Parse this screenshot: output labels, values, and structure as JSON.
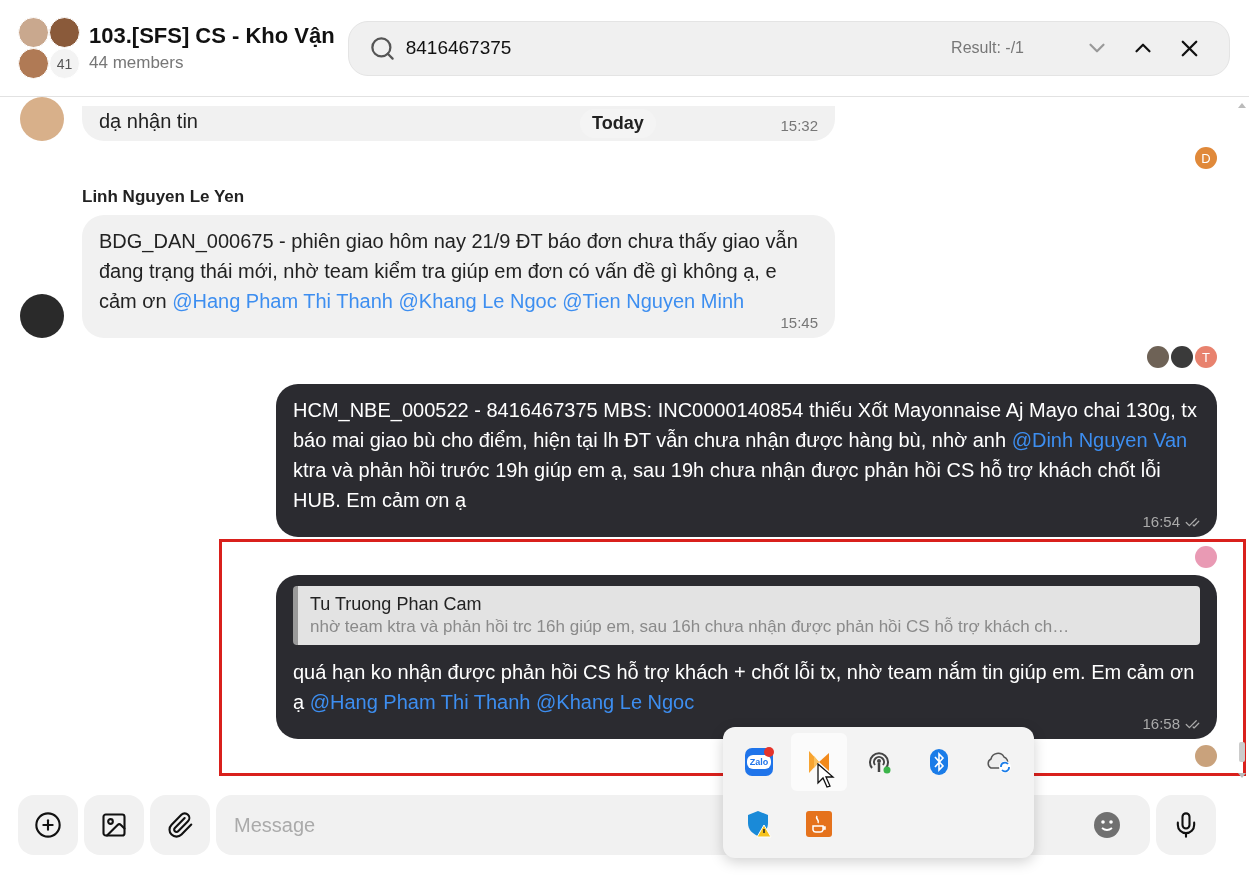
{
  "header": {
    "title": "103.[SFS] CS - Kho Vận",
    "subtitle": "44 members",
    "member_count": "41"
  },
  "search": {
    "value": "8416467375",
    "result": "Result: -/1",
    "next_disabled": true,
    "prev_disabled": false
  },
  "date_label": "Today",
  "rows": [
    {
      "kind": "message",
      "outgoing": false,
      "avatar": true,
      "top_cut": true,
      "highlighted": false,
      "time": "15:32",
      "parts": [
        {
          "kind": "text",
          "text": "dạ nhận tin"
        }
      ]
    },
    {
      "kind": "receipts",
      "highlighted": false,
      "readers": [
        {
          "kind": "letter",
          "letter": "D",
          "color": "#e0893a"
        }
      ]
    },
    {
      "kind": "sender",
      "name": "Linh Nguyen Le Yen"
    },
    {
      "kind": "message",
      "outgoing": false,
      "avatar": true,
      "top_cut": false,
      "highlighted": false,
      "time": "15:45",
      "parts": [
        {
          "kind": "text",
          "text": "BDG_DAN_000675 - phiên giao hôm nay 21/9 ĐT báo đơn chưa thấy giao vẫn đang trạng thái mới, nhờ team kiểm tra giúp em đơn có vấn đề gì không ạ, e cảm ơn "
        },
        {
          "kind": "mention",
          "text": "@Hang Pham Thi Thanh"
        },
        {
          "kind": "mention",
          "text": "@Khang Le Ngoc"
        },
        {
          "kind": "mention",
          "text": "@Tien Nguyen Minh"
        }
      ]
    },
    {
      "kind": "receipts",
      "highlighted": false,
      "readers": [
        {
          "kind": "photo",
          "color": "#6e6256"
        },
        {
          "kind": "photo",
          "color": "#3a3a3a"
        },
        {
          "kind": "letter",
          "letter": "T",
          "color": "#e8826e"
        }
      ]
    },
    {
      "kind": "message",
      "outgoing": true,
      "top_cut": false,
      "read": true,
      "highlighted": false,
      "time": "16:54",
      "parts": [
        {
          "kind": "text",
          "text": "HCM_NBE_000522 - 8416467375 MBS: INC0000140854 thiếu Xốt Mayonnaise Aj Mayo chai 130g, tx báo mai giao bù cho điểm, hiện tại lh ĐT vẫn chưa nhận được hàng bù, nhờ anh "
        },
        {
          "kind": "mention",
          "text": "@Dinh Nguyen Van"
        },
        {
          "kind": "text",
          "text": " ktra và phản hồi trước 19h giúp em ạ, sau 19h chưa nhận được phản hồi CS hỗ trợ khách chốt lỗi HUB. Em cảm ơn ạ"
        }
      ]
    },
    {
      "kind": "receipts",
      "highlighted": true,
      "readers": [
        {
          "kind": "photo",
          "color": "#e99ab4"
        }
      ]
    },
    {
      "kind": "message",
      "outgoing": true,
      "top_cut": false,
      "read": true,
      "highlighted": true,
      "time": "16:58",
      "quote": {
        "sender": "Tu Truong Phan Cam",
        "text": "nhờ team ktra và phản hồi trc 16h giúp em, sau 16h chưa nhận được phản hồi CS hỗ trợ khách ch…"
      },
      "parts": [
        {
          "kind": "text",
          "text": "quá hạn ko nhận được phản hồi CS hỗ trợ khách + chốt lỗi tx, nhờ team nắm tin giúp em. Em cảm ơn ạ "
        },
        {
          "kind": "mention",
          "text": "@Hang Pham Thi Thanh"
        },
        {
          "kind": "mention",
          "text": "@Khang Le Ngoc"
        }
      ]
    },
    {
      "kind": "receipts",
      "highlighted": true,
      "readers": [
        {
          "kind": "photo",
          "color": "#c9a27c"
        }
      ]
    }
  ],
  "composer": {
    "placeholder": "Message"
  },
  "tray": {
    "items": [
      {
        "kind": "chat-app",
        "label": "Zalo",
        "badge": true,
        "hovered": false
      },
      {
        "kind": "orange-app",
        "badge": false,
        "hovered": true
      },
      {
        "kind": "hotspot",
        "badge": false,
        "hovered": false
      },
      {
        "kind": "bluetooth",
        "badge": false,
        "hovered": false
      },
      {
        "kind": "cloud-sync",
        "badge": false,
        "hovered": false
      },
      {
        "kind": "shield-warning",
        "badge": false,
        "hovered": false
      },
      {
        "kind": "orange-cup",
        "badge": false,
        "hovered": false
      }
    ]
  }
}
